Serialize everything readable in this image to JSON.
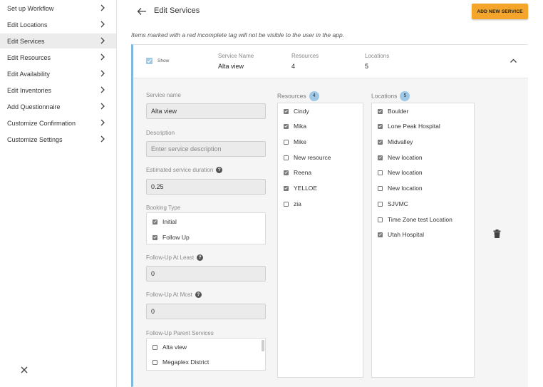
{
  "sidebar": {
    "items": [
      {
        "label": "Set up Workflow"
      },
      {
        "label": "Edit Locations"
      },
      {
        "label": "Edit Services"
      },
      {
        "label": "Edit Resources"
      },
      {
        "label": "Edit Availability"
      },
      {
        "label": "Edit Inventories"
      },
      {
        "label": "Add Questionnaire"
      },
      {
        "label": "Customize Confirmation"
      },
      {
        "label": "Customize Settings"
      }
    ],
    "active_index": 2
  },
  "header": {
    "title": "Edit Services",
    "add_button": "ADD NEW SERVICE",
    "note": "Items marked with a red incomplete tag will not be visible to the user in the app."
  },
  "service": {
    "show_label": "Show",
    "show_checked": true,
    "summary": {
      "name_label": "Service Name",
      "name_value": "Alta view",
      "resources_label": "Resources",
      "resources_value": "4",
      "locations_label": "Locations",
      "locations_value": "5"
    },
    "form": {
      "service_name_label": "Service name",
      "service_name_value": "Alta view",
      "description_label": "Description",
      "description_placeholder": "Enter service description",
      "duration_label": "Estimated service duration",
      "duration_value": "0.25",
      "booking_type_label": "Booking Type",
      "booking_types": [
        {
          "label": "Initial",
          "checked": true
        },
        {
          "label": "Follow Up",
          "checked": true
        }
      ],
      "followup_least_label": "Follow-Up At Least",
      "followup_least_value": "0",
      "followup_most_label": "Follow-Up At Most",
      "followup_most_value": "0",
      "parent_services_label": "Follow-Up Parent Services",
      "parent_services": [
        {
          "label": "Alta view",
          "checked": false
        },
        {
          "label": "Megaplex District",
          "checked": false
        }
      ]
    },
    "resources": {
      "title": "Resources",
      "count": "4",
      "items": [
        {
          "label": "Cindy",
          "checked": true
        },
        {
          "label": "Mika",
          "checked": true
        },
        {
          "label": "Mike",
          "checked": false
        },
        {
          "label": "New resource",
          "checked": false
        },
        {
          "label": "Reena",
          "checked": true
        },
        {
          "label": "YELLOE",
          "checked": true
        },
        {
          "label": "zia",
          "checked": false
        }
      ]
    },
    "locations": {
      "title": "Locations",
      "count": "5",
      "items": [
        {
          "label": "Boulder",
          "checked": true
        },
        {
          "label": "Lone Peak Hospital",
          "checked": true
        },
        {
          "label": "Midvalley",
          "checked": true
        },
        {
          "label": "New location",
          "checked": true
        },
        {
          "label": "New location",
          "checked": false
        },
        {
          "label": "New location",
          "checked": false
        },
        {
          "label": "SJVMC",
          "checked": false
        },
        {
          "label": "Time Zone test Location",
          "checked": false
        },
        {
          "label": "Utah Hospital",
          "checked": true
        }
      ]
    }
  },
  "colors": {
    "accent": "#f4a62a",
    "highlight": "#9fc8e5",
    "card_border": "#7db8de"
  }
}
